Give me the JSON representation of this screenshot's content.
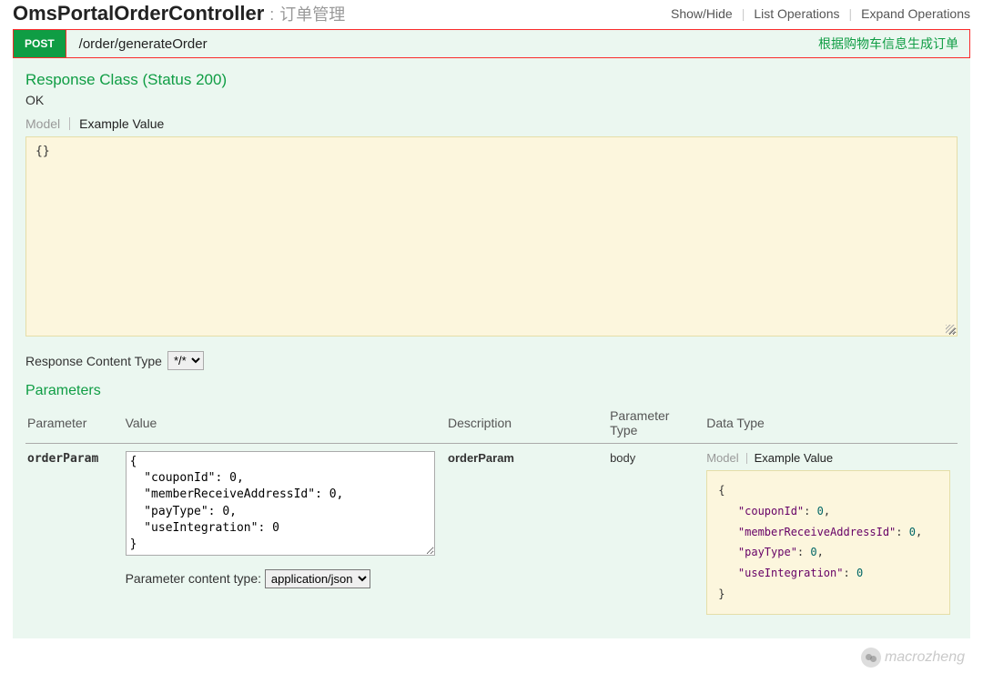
{
  "controller": {
    "name": "OmsPortalOrderController",
    "sep": ":",
    "desc": "订单管理"
  },
  "headerLinks": {
    "showHide": "Show/Hide",
    "listOps": "List Operations",
    "expandOps": "Expand Operations"
  },
  "operation": {
    "method": "POST",
    "path": "/order/generateOrder",
    "summary": "根据购物车信息生成订单"
  },
  "responseClass": {
    "title": "Response Class (Status 200)",
    "statusText": "OK"
  },
  "modelTabs": {
    "model": "Model",
    "example": "Example Value"
  },
  "responseExample": "{}",
  "responseContentType": {
    "label": "Response Content Type",
    "value": "*/*"
  },
  "parameters": {
    "title": "Parameters",
    "headers": {
      "parameter": "Parameter",
      "value": "Value",
      "description": "Description",
      "paramType": "Parameter Type",
      "dataType": "Data Type"
    },
    "rows": [
      {
        "name": "orderParam",
        "value": "{\n  \"couponId\": 0,\n  \"memberReceiveAddressId\": 0,\n  \"payType\": 0,\n  \"useIntegration\": 0\n}",
        "description": "orderParam",
        "paramType": "body",
        "dataTypeExample": {
          "couponId": 0,
          "memberReceiveAddressId": 0,
          "payType": 0,
          "useIntegration": 0
        }
      }
    ]
  },
  "paramContentType": {
    "label": "Parameter content type:",
    "value": "application/json"
  },
  "watermark": "macrozheng"
}
